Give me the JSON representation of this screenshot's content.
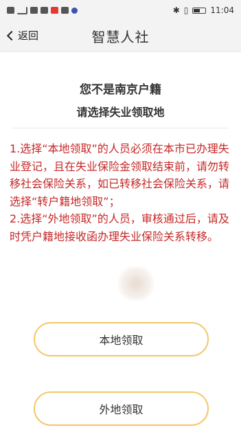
{
  "statusbar": {
    "left_icons": [
      "hd-icon",
      "signal-icon",
      "wifi-icon",
      "chat-icon",
      "red-app-icon",
      "message-icon",
      "blue-app-icon"
    ],
    "time": "11:04"
  },
  "nav": {
    "back_label": "返回",
    "title": "智慧人社"
  },
  "heading": {
    "line1": "您不是南京户籍",
    "line2": "请选择失业领取地"
  },
  "notice": {
    "para1": "1.选择“本地领取”的人员必须在本市已办理失业登记，且在失业保险金领取结束前，请勿转移社会保险关系，如已转移社会保险关系，请选择“转户籍地领取”；",
    "para2": "2.选择“外地领取”的人员，审核通过后，请及时凭户籍地接收函办理失业保险关系转移。"
  },
  "buttons": {
    "local": "本地领取",
    "remote": "外地领取"
  },
  "colors": {
    "notice_text": "#c62828",
    "button_border": "#f4c767",
    "header_bg": "#f3f3f3"
  }
}
